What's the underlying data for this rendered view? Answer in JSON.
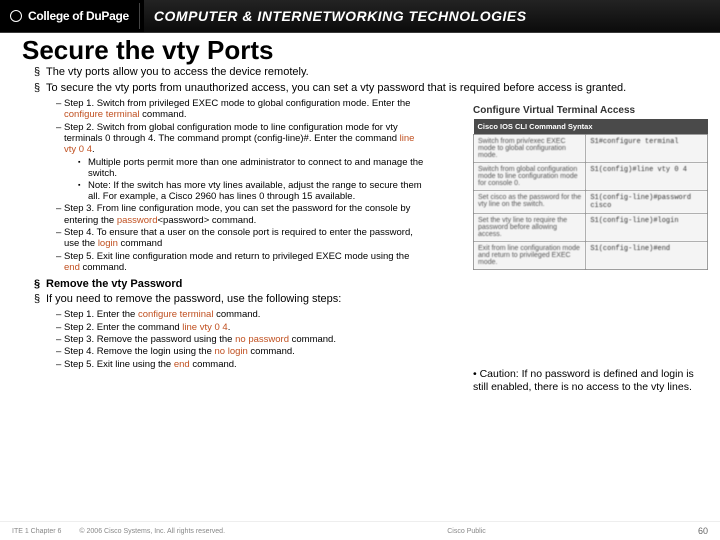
{
  "header": {
    "college": "College of DuPage",
    "banner": "COMPUTER & INTERNETWORKING TECHNOLOGIES"
  },
  "title": "Secure the vty Ports",
  "bul1": "The vty ports allow you to access the device remotely.",
  "bul2": "To secure the vty ports from unauthorized access, you can set a vty password that is required before access is granted.",
  "steps1": {
    "s1a": "Step 1. Switch from privileged EXEC mode to global configuration mode. Enter the ",
    "s1k": "configure terminal",
    "s1b": " command.",
    "s2a": "Step 2. Switch from global configuration mode to line configuration mode for vty terminals 0 through 4. The command prompt (config-line)#. Enter the command ",
    "s2k": "line vty 0 4",
    "s2b": ".",
    "s2sub1": "Multiple ports permit more than one administrator to connect to and manage the switch.",
    "s2sub2": "Note: If the switch has more vty lines available, adjust the range to secure them all. For example, a Cisco 2960 has lines 0 through 15 available.",
    "s3a": "Step 3. From line configuration mode, you can set the password for the console by entering the ",
    "s3k": "password",
    "s3m": "<password>",
    "s3b": " command.",
    "s4a": "Step 4. To ensure that a user on the console port is required to enter the password, use the ",
    "s4k": "login",
    "s4b": " command",
    "s5a": "Step 5. Exit line configuration mode and return to privileged EXEC mode using the ",
    "s5k": "end",
    "s5b": " command."
  },
  "bul3": "Remove the vty Password",
  "bul4": "If you need to remove the password, use the following steps:",
  "steps2": {
    "s1a": "Step 1. Enter the ",
    "s1k": "configure terminal",
    "s1b": " command.",
    "s2a": "Step 2. Enter the command ",
    "s2k": "line vty 0 4",
    "s2b": ".",
    "s3a": "Step 3. Remove the password using the ",
    "s3k": "no password",
    "s3b": " command.",
    "s4a": "Step 4. Remove the login using the ",
    "s4k": "no login",
    "s4b": " command.",
    "s5a": "Step 5. Exit line using the ",
    "s5k": "end",
    "s5b": " command."
  },
  "right": {
    "title": "Configure Virtual Terminal Access",
    "table_header": "Cisco IOS CLI Command Syntax",
    "rows": [
      {
        "l": "Switch from priv/exec EXEC mode to global configuration mode.",
        "r": "S1#configure terminal"
      },
      {
        "l": "Switch from global configuration mode to line configuration mode for console 0.",
        "r": "S1(config)#line vty 0 4"
      },
      {
        "l": "Set cisco as the password for the vty line on the switch.",
        "r": "S1(config-line)#password cisco"
      },
      {
        "l": "Set the vty line to require the password before allowing access.",
        "r": "S1(config-line)#login"
      },
      {
        "l": "Exit from line configuration mode and return to privileged EXEC mode.",
        "r": "S1(config-line)#end"
      }
    ],
    "caution": "• Caution: If no password is defined and login is still enabled, there is no access to the vty lines."
  },
  "footer": {
    "l": "ITE 1 Chapter 6",
    "c": "© 2006 Cisco Systems, Inc. All rights reserved.",
    "m": "Cisco Public",
    "page": "60"
  }
}
